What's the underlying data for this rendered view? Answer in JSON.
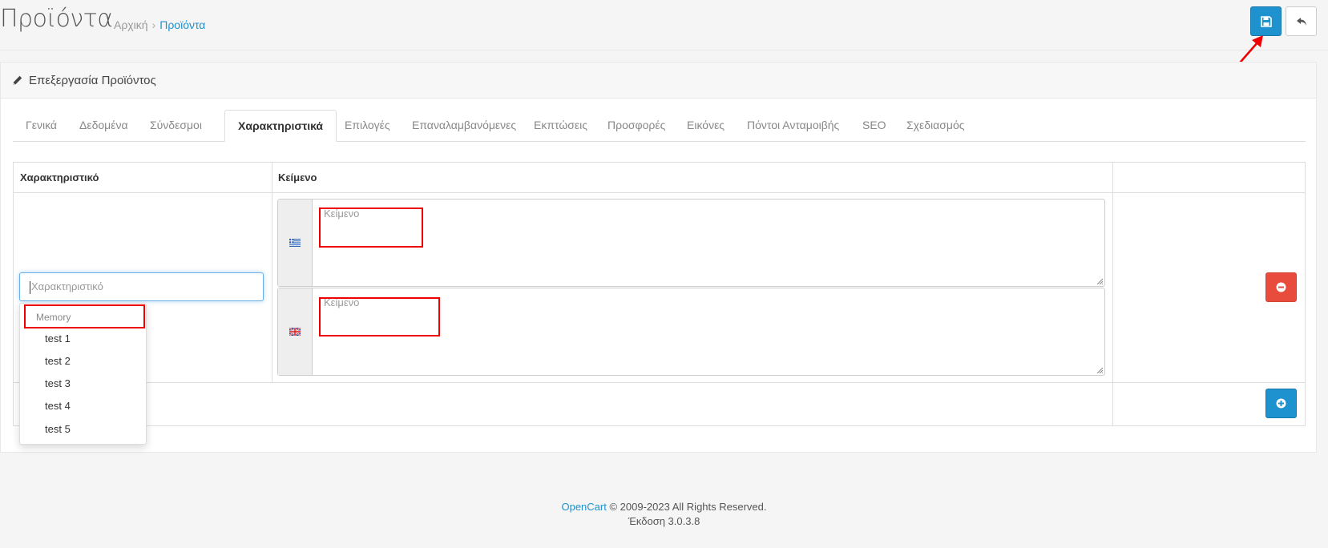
{
  "header": {
    "title": "Προϊόντα",
    "breadcrumb": [
      {
        "label": "Αρχική"
      },
      {
        "label": "Προϊόντα"
      }
    ],
    "separator": "›"
  },
  "panel": {
    "heading": "Επεξεργασία Προϊόντος"
  },
  "tabs": [
    {
      "label": "Γενικά",
      "active": false
    },
    {
      "label": "Δεδομένα",
      "active": false
    },
    {
      "label": "Σύνδεσμοι",
      "active": false
    },
    {
      "label": "Χαρακτηριστικά",
      "active": true
    },
    {
      "label": "Επιλογές",
      "active": false
    },
    {
      "label": "Επαναλαμβανόμενες",
      "active": false
    },
    {
      "label": "Εκπτώσεις",
      "active": false
    },
    {
      "label": "Προσφορές",
      "active": false
    },
    {
      "label": "Εικόνες",
      "active": false
    },
    {
      "label": "Πόντοι Ανταμοιβής",
      "active": false
    },
    {
      "label": "SEO",
      "active": false
    },
    {
      "label": "Σχεδιασμός",
      "active": false
    }
  ],
  "table": {
    "headers": [
      "Χαρακτηριστικό",
      "Κείμενο",
      ""
    ],
    "attribute_input": {
      "value": "",
      "placeholder": "Χαρακτηριστικό"
    },
    "textareas": [
      {
        "language": "greek-flag-icon",
        "placeholder": "Κείμενο",
        "value": ""
      },
      {
        "language": "uk-flag-icon",
        "placeholder": "Κείμενο",
        "value": ""
      }
    ]
  },
  "dropdown": {
    "group": "Memory",
    "items": [
      "test 1",
      "test 2",
      "test 3",
      "test 4",
      "test 5"
    ]
  },
  "colors": {
    "primary": "#1e91cf",
    "danger": "#e74c3c",
    "annotation": "#e00000"
  },
  "footer": {
    "brand": "OpenCart",
    "copyright": "© 2009-2023 All Rights Reserved.",
    "version": "Έκδοση 3.0.3.8"
  }
}
